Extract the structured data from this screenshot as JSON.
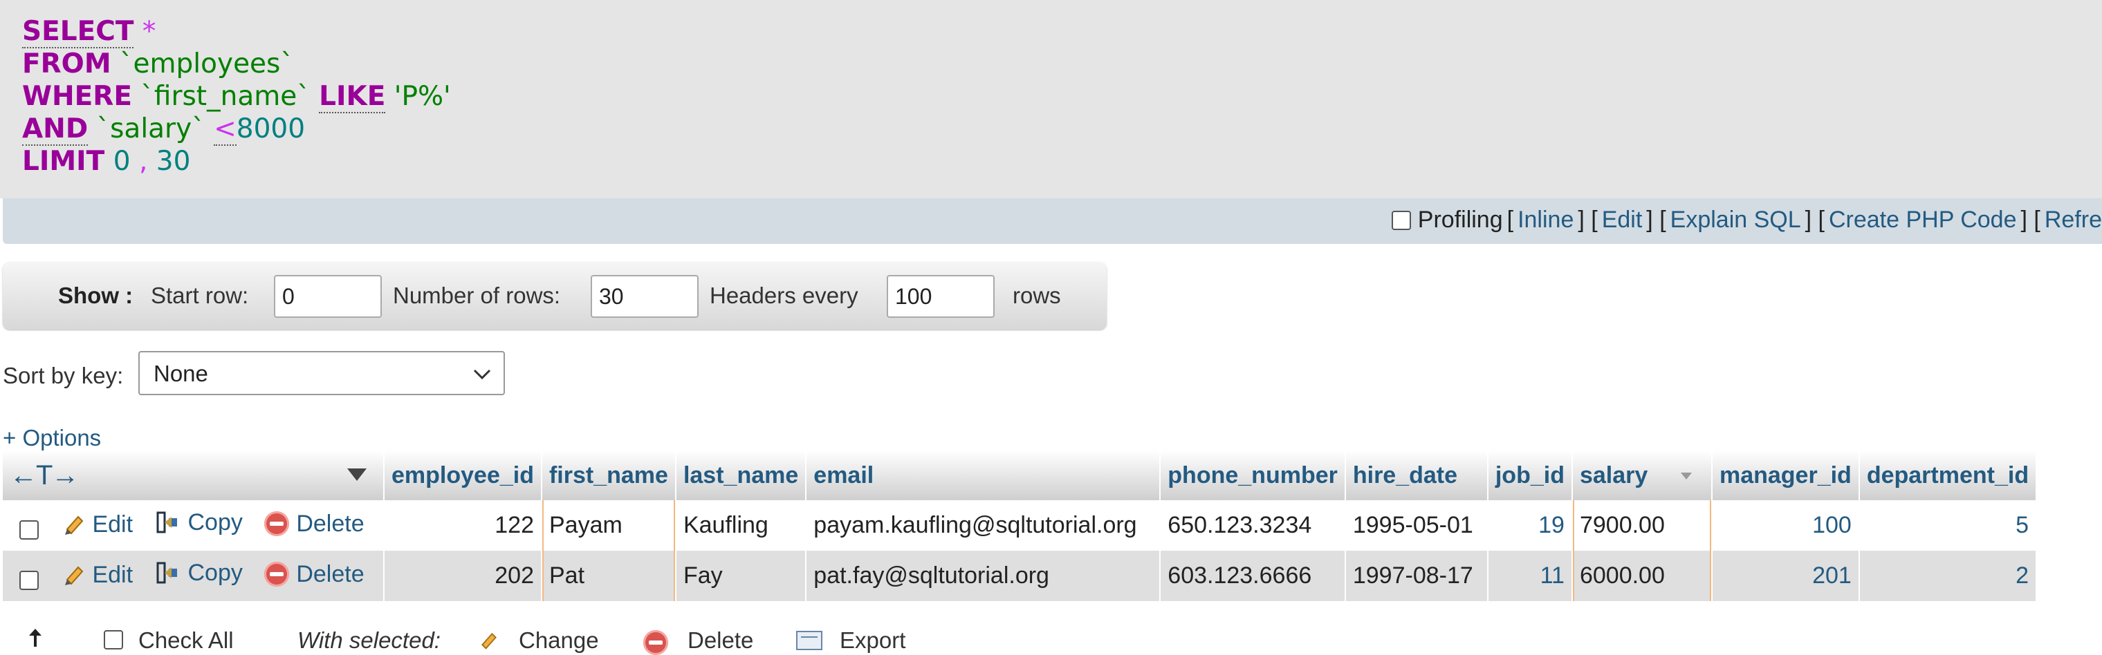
{
  "sql": {
    "line1": {
      "kw": "SELECT",
      "op": "*"
    },
    "line2": {
      "kw": "FROM",
      "ident": "`employees`"
    },
    "line3": {
      "kw": "WHERE",
      "ident": "`first_name`",
      "kw2": "LIKE",
      "str": "'P%'"
    },
    "line4": {
      "kw": "AND",
      "ident": "`salary`",
      "op": "<",
      "num": "8000"
    },
    "line5": {
      "kw": "LIMIT",
      "num1": "0",
      "op": ",",
      "num2": "30"
    }
  },
  "toolbar": {
    "profiling": "Profiling",
    "links": [
      "Inline",
      "Edit",
      "Explain SQL",
      "Create PHP Code",
      "Refre"
    ]
  },
  "show": {
    "label": "Show :",
    "start_row_label": "Start row:",
    "start_row_value": "0",
    "num_rows_label": "Number of rows:",
    "num_rows_value": "30",
    "headers_label": "Headers every",
    "headers_value": "100",
    "rows_label": "rows"
  },
  "sort": {
    "label": "Sort by key:",
    "value": "None"
  },
  "options_label": "+ Options",
  "table": {
    "nav_arrows": "←T→",
    "columns": [
      "employee_id",
      "first_name",
      "last_name",
      "email",
      "phone_number",
      "hire_date",
      "job_id",
      "salary",
      "manager_id",
      "department_id"
    ],
    "actions": {
      "edit": "Edit",
      "copy": "Copy",
      "delete": "Delete"
    },
    "rows": [
      {
        "employee_id": "122",
        "first_name": "Payam",
        "last_name": "Kaufling",
        "email": "payam.kaufling@sqltutorial.org",
        "phone_number": "650.123.3234",
        "hire_date": "1995-05-01",
        "job_id": "19",
        "salary": "7900.00",
        "manager_id": "100",
        "department_id": "5"
      },
      {
        "employee_id": "202",
        "first_name": "Pat",
        "last_name": "Fay",
        "email": "pat.fay@sqltutorial.org",
        "phone_number": "603.123.6666",
        "hire_date": "1997-08-17",
        "job_id": "11",
        "salary": "6000.00",
        "manager_id": "201",
        "department_id": "2"
      }
    ]
  },
  "footer": {
    "check_all": "Check All",
    "with_selected": "With selected:",
    "change": "Change",
    "delete": "Delete",
    "export": "Export"
  },
  "colors": {
    "link": "#235a81",
    "keyword": "#990099",
    "identifier": "#008000",
    "number": "#008080",
    "toolbar_bg": "#d3dce3",
    "delete_red": "#d9534f"
  }
}
